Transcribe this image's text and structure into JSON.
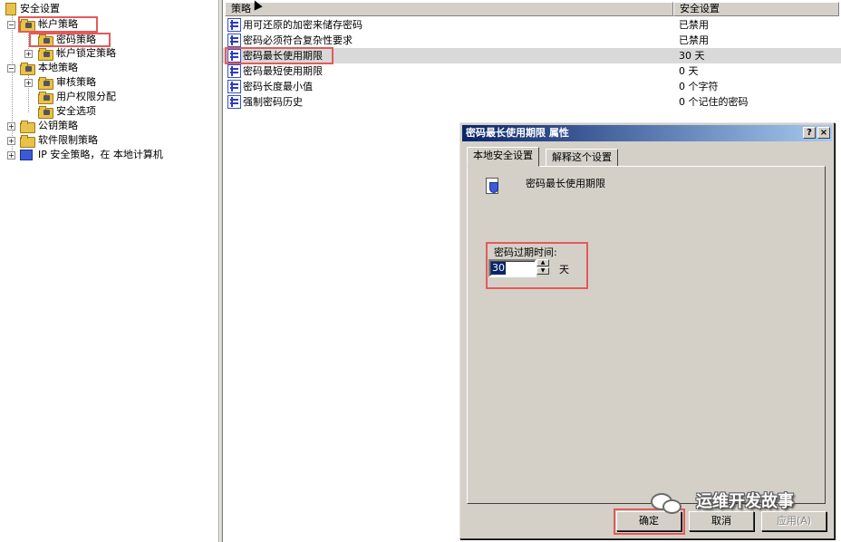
{
  "tree": {
    "root": "安全设置",
    "account_policies": "帐户策略",
    "password_policy": "密码策略",
    "lockout_policy": "帐户锁定策略",
    "local_policies": "本地策略",
    "audit_policy": "审核策略",
    "user_rights": "用户权限分配",
    "security_options": "安全选项",
    "public_key": "公钥策略",
    "software_restriction": "软件限制策略",
    "ip_security": "IP 安全策略，在 本地计算机"
  },
  "list": {
    "col_policy": "策略",
    "col_setting": "安全设置",
    "rows": [
      {
        "name": "用可还原的加密来储存密码",
        "value": "已禁用"
      },
      {
        "name": "密码必须符合复杂性要求",
        "value": "已禁用"
      },
      {
        "name": "密码最长使用期限",
        "value": "30 天"
      },
      {
        "name": "密码最短使用期限",
        "value": "0 天"
      },
      {
        "name": "密码长度最小值",
        "value": "0 个字符"
      },
      {
        "name": "强制密码历史",
        "value": "0 个记住的密码"
      }
    ]
  },
  "dialog": {
    "title": "密码最长使用期限 属性",
    "help_btn": "?",
    "close_btn": "×",
    "tab_local": "本地安全设置",
    "tab_explain": "解释这个设置",
    "policy_name": "密码最长使用期限",
    "expire_label": "密码过期时间:",
    "expire_value": "30",
    "unit": "天",
    "ok": "确定",
    "cancel": "取消",
    "apply": "应用(A)"
  },
  "watermark": "运维开发故事"
}
